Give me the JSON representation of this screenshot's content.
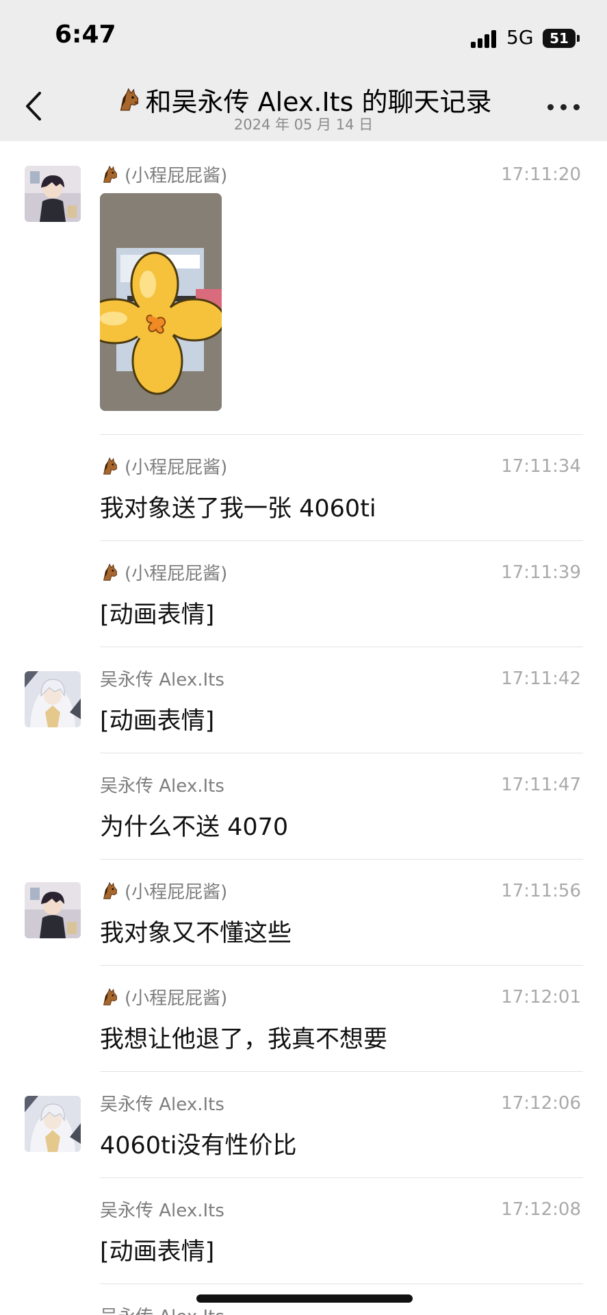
{
  "status_bar": {
    "time": "6:47",
    "network": "5G",
    "battery": "51"
  },
  "header": {
    "title": "和吴永传 Alex.Its 的聊天记录",
    "title_icon": "horse-face-icon",
    "date": "2024 年 05 月 14 日"
  },
  "messages": [
    {
      "sender": "(小程屁屁酱)",
      "sender_icon": "horse-face-icon",
      "time": "17:11:20",
      "type": "image",
      "avatar": "avatar-a"
    },
    {
      "sender": "(小程屁屁酱)",
      "sender_icon": "horse-face-icon",
      "time": "17:11:34",
      "text": "我对象送了我一张 4060ti"
    },
    {
      "sender": "(小程屁屁酱)",
      "sender_icon": "horse-face-icon",
      "time": "17:11:39",
      "text": "[动画表情]"
    },
    {
      "sender": "吴永传 Alex.Its",
      "time": "17:11:42",
      "text": "[动画表情]",
      "avatar": "avatar-b"
    },
    {
      "sender": "吴永传 Alex.Its",
      "time": "17:11:47",
      "text": "为什么不送 4070"
    },
    {
      "sender": "(小程屁屁酱)",
      "sender_icon": "horse-face-icon",
      "time": "17:11:56",
      "text": "我对象又不懂这些",
      "avatar": "avatar-a"
    },
    {
      "sender": "(小程屁屁酱)",
      "sender_icon": "horse-face-icon",
      "time": "17:12:01",
      "text": "我想让他退了，我真不想要"
    },
    {
      "sender": "吴永传 Alex.Its",
      "time": "17:12:06",
      "text": "4060ti没有性价比",
      "avatar": "avatar-b"
    },
    {
      "sender": "吴永传 Alex.Its",
      "time": "17:12:08",
      "text": "[动画表情]"
    },
    {
      "sender": "吴永传 Alex.Its"
    }
  ],
  "colors": {
    "header_bg": "#ededed",
    "page_bg": "#ffffff",
    "meta_text": "#7d7d7d",
    "time_text": "#a9a9a9",
    "divider": "#e2e2e2",
    "sticker_yellow": "#f6c23c"
  }
}
